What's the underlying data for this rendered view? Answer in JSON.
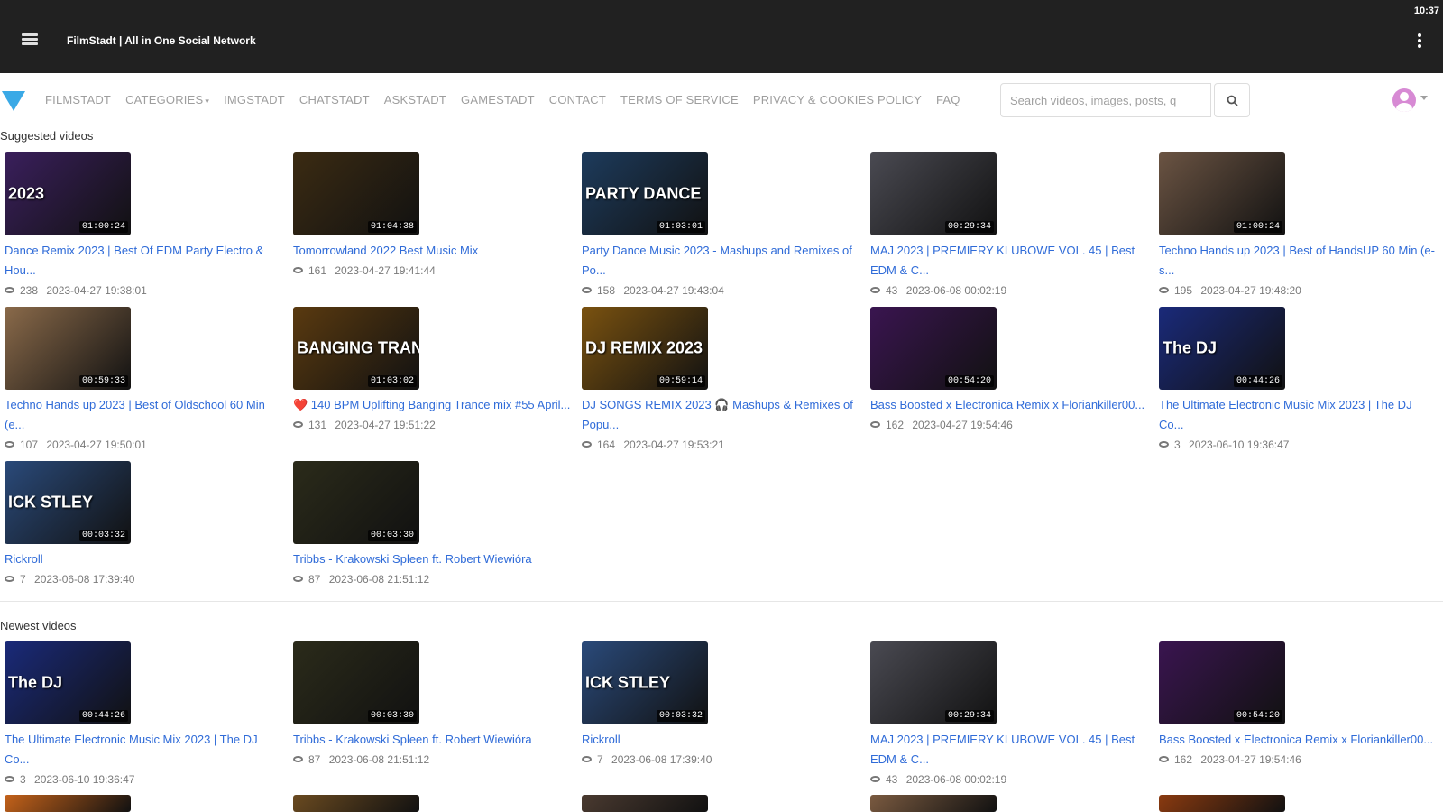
{
  "statusbar": {
    "time": "10:37"
  },
  "appbar": {
    "title": "FilmStadt | All in One Social Network"
  },
  "navbar": {
    "items": [
      "FILMSTADT",
      "CATEGORIES",
      "IMGSTADT",
      "CHATSTADT",
      "ASKSTADT",
      "GAMESTADT",
      "CONTACT",
      "TERMS OF SERVICE",
      "PRIVACY & COOKIES POLICY",
      "FAQ"
    ],
    "search_placeholder": "Search videos, images, posts, q"
  },
  "sections": {
    "suggested": {
      "title": "Suggested videos",
      "videos": [
        {
          "title": "Dance Remix 2023 | Best Of EDM Party Electro & Hou...",
          "views": "238",
          "date": "2023-04-27 19:38:01",
          "duration": "01:00:24",
          "thumb_text": "2023",
          "thumb_color": "#3a1f5c"
        },
        {
          "title": "Tomorrowland 2022 Best Music Mix",
          "views": "161",
          "date": "2023-04-27 19:41:44",
          "duration": "01:04:38",
          "thumb_text": "",
          "thumb_color": "#3b2b12"
        },
        {
          "title": "Party Dance Music 2023 - Mashups and Remixes of Po...",
          "views": "158",
          "date": "2023-04-27 19:43:04",
          "duration": "01:03:01",
          "thumb_text": "PARTY DANCE",
          "thumb_color": "#1d3b5c"
        },
        {
          "title": "MAJ 2023 | PREMIERY KLUBOWE VOL. 45 | Best EDM & C...",
          "views": "43",
          "date": "2023-06-08 00:02:19",
          "duration": "00:29:34",
          "thumb_text": "",
          "thumb_color": "#4a4a52"
        },
        {
          "title": "Techno Hands up 2023 | Best of HandsUP 60 Min (e-s...",
          "views": "195",
          "date": "2023-04-27 19:48:20",
          "duration": "01:00:24",
          "thumb_text": "",
          "thumb_color": "#6b5443"
        },
        {
          "title": "Techno Hands up 2023 | Best of Oldschool 60 Min (e...",
          "views": "107",
          "date": "2023-04-27 19:50:01",
          "duration": "00:59:33",
          "thumb_text": "",
          "thumb_color": "#8a6a4a"
        },
        {
          "title": "❤️ 140 BPM Uplifting Banging Trance mix #55 April...",
          "views": "131",
          "date": "2023-04-27 19:51:22",
          "duration": "01:03:02",
          "thumb_text": "BANGING TRANCE",
          "thumb_color": "#5a3a10"
        },
        {
          "title": "DJ SONGS REMIX 2023 🎧 Mashups & Remixes of Popu...",
          "views": "164",
          "date": "2023-04-27 19:53:21",
          "duration": "00:59:14",
          "thumb_text": "DJ REMIX 2023",
          "thumb_color": "#7a5210"
        },
        {
          "title": "Bass Boosted x Electronica Remix x Floriankiller00...",
          "views": "162",
          "date": "2023-04-27 19:54:46",
          "duration": "00:54:20",
          "thumb_text": "",
          "thumb_color": "#3a1550"
        },
        {
          "title": "The Ultimate Electronic Music Mix 2023 | The DJ Co...",
          "views": "3",
          "date": "2023-06-10 19:36:47",
          "duration": "00:44:26",
          "thumb_text": "The DJ",
          "thumb_color": "#1a2a7a"
        },
        {
          "title": "Rickroll",
          "views": "7",
          "date": "2023-06-08 17:39:40",
          "duration": "00:03:32",
          "thumb_text": "ICK STLEY",
          "thumb_color": "#2a4a7a"
        },
        {
          "title": "Tribbs - Krakowski Spleen ft. Robert Wiewióra",
          "views": "87",
          "date": "2023-06-08 21:51:12",
          "duration": "00:03:30",
          "thumb_text": "",
          "thumb_color": "#2b2b1a"
        }
      ]
    },
    "newest": {
      "title": "Newest videos",
      "videos": [
        {
          "title": "The Ultimate Electronic Music Mix 2023 | The DJ Co...",
          "views": "3",
          "date": "2023-06-10 19:36:47",
          "duration": "00:44:26",
          "thumb_text": "The DJ",
          "thumb_color": "#1a2a7a"
        },
        {
          "title": "Tribbs - Krakowski Spleen ft. Robert Wiewióra",
          "views": "87",
          "date": "2023-06-08 21:51:12",
          "duration": "00:03:30",
          "thumb_text": "",
          "thumb_color": "#2b2b1a"
        },
        {
          "title": "Rickroll",
          "views": "7",
          "date": "2023-06-08 17:39:40",
          "duration": "00:03:32",
          "thumb_text": "ICK STLEY",
          "thumb_color": "#2a4a7a"
        },
        {
          "title": "MAJ 2023 | PREMIERY KLUBOWE VOL. 45 | Best EDM & C...",
          "views": "43",
          "date": "2023-06-08 00:02:19",
          "duration": "00:29:34",
          "thumb_text": "",
          "thumb_color": "#4a4a52"
        },
        {
          "title": "Bass Boosted x Electronica Remix x Floriankiller00...",
          "views": "162",
          "date": "2023-04-27 19:54:46",
          "duration": "00:54:20",
          "thumb_text": "",
          "thumb_color": "#3a1550"
        }
      ],
      "next_row_thumb_colors": [
        "#c4621a",
        "#6a4a20",
        "#4a3a30",
        "#7a5a40",
        "#8a3a10"
      ]
    }
  },
  "colors": {
    "link": "#2f6bd8",
    "appbar": "#212121",
    "logo": "#3aa9e6"
  }
}
